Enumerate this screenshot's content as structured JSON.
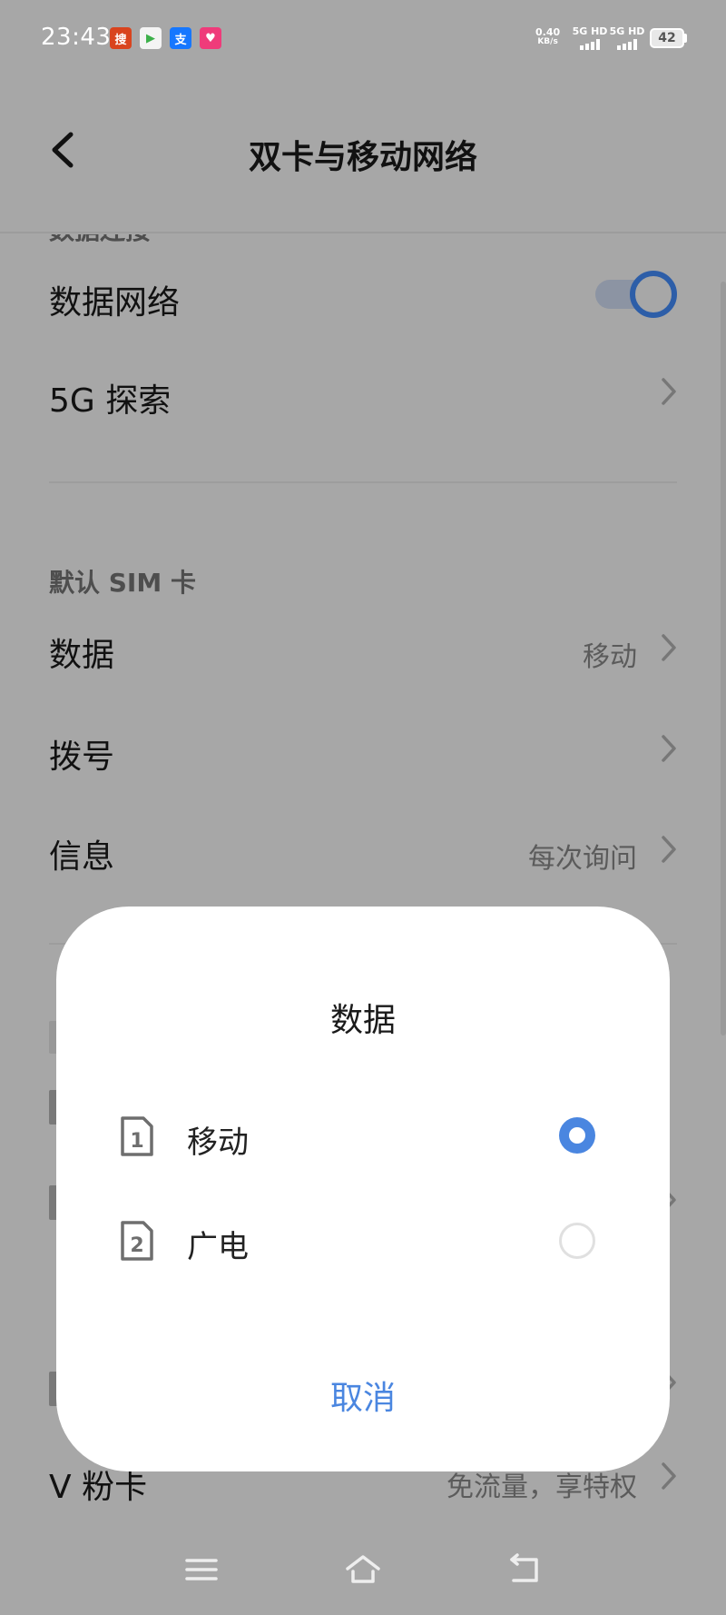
{
  "status_bar": {
    "time": "23:43",
    "speed_value": "0.40",
    "speed_unit": "KB/s",
    "sim1_label": "5G HD",
    "sim2_label": "5G HD",
    "battery": "42",
    "app_icons": [
      {
        "name": "lottery-app-icon",
        "glyph": "搜",
        "color": "#d9441e"
      },
      {
        "name": "video-app-icon",
        "glyph": "▶",
        "color": "#3cb04a"
      },
      {
        "name": "alipay-icon",
        "glyph": "支",
        "color": "#1677ff"
      },
      {
        "name": "pink-app-icon",
        "glyph": "♥",
        "color": "#ef3b7a"
      }
    ]
  },
  "header": {
    "title": "双卡与移动网络",
    "back_icon": "chevron-left-icon"
  },
  "list": {
    "partial_section": "数据连接",
    "data_network_label": "数据网络",
    "data_network_on": true,
    "explore_5g_label": "5G 探索",
    "default_sim_section": "默认 SIM 卡",
    "data_label": "数据",
    "data_value": "移动",
    "dial_label": "拨号",
    "message_label": "信息",
    "message_value": "每次询问",
    "vcard_label": "V 粉卡",
    "vcard_value": "免流量，享特权"
  },
  "dialog": {
    "title": "数据",
    "options": [
      {
        "label": "移动",
        "sim_number": "1",
        "selected": true
      },
      {
        "label": "广电",
        "sim_number": "2",
        "selected": false
      }
    ],
    "cancel_label": "取消"
  },
  "colors": {
    "accent": "#4a86e0",
    "toggle_knob": "#2d5ea8"
  }
}
